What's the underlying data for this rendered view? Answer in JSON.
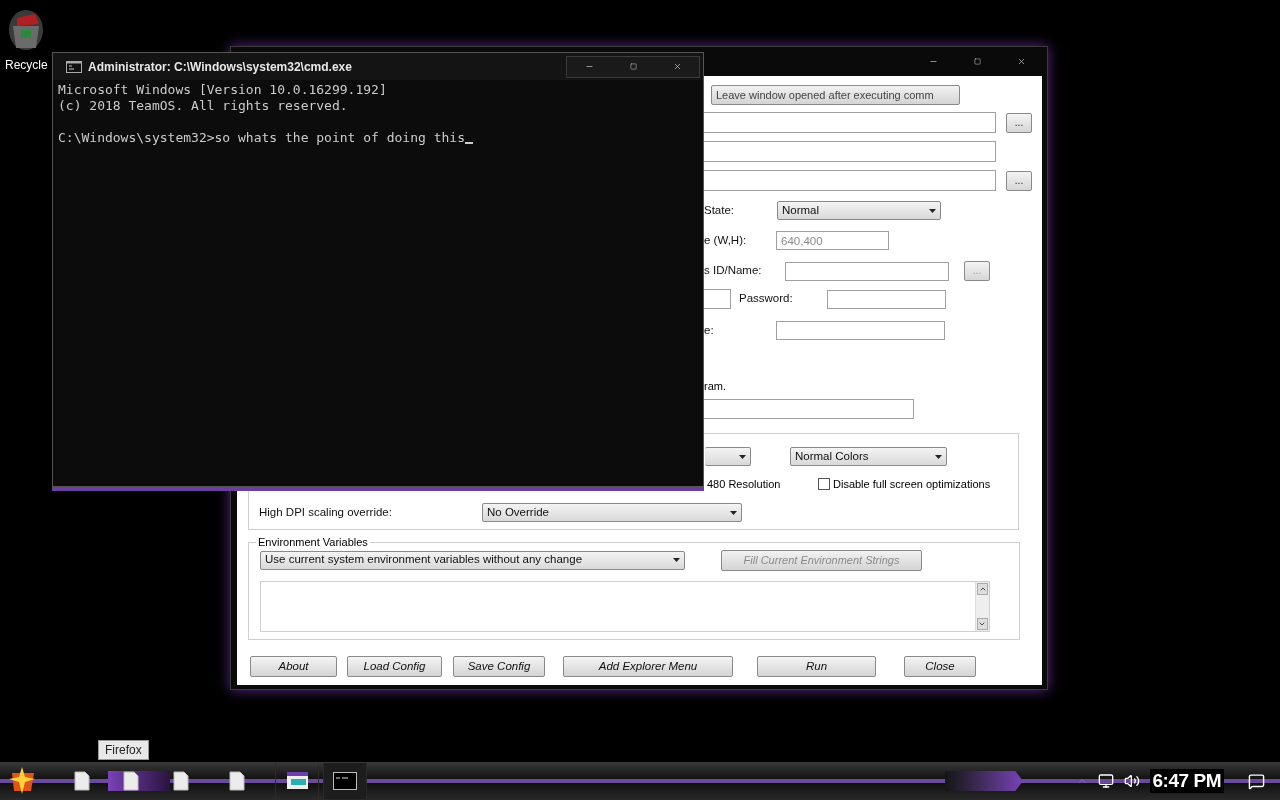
{
  "desktop_icons": [
    {
      "label": "Recycle"
    }
  ],
  "cmd_window": {
    "title": "Administrator: C:\\Windows\\system32\\cmd.exe",
    "lines": [
      "Microsoft Windows [Version 10.0.16299.192]",
      "(c) 2018 TeamOS. All rights reserved."
    ],
    "prompt": "C:\\Windows\\system32>so whats the point of doing this"
  },
  "dialog": {
    "leave_open_button": {
      "label": "Leave window opened after executing comm"
    },
    "path_fields": [
      {
        "kind": "browse",
        "browse": {
          "label": "...",
          "disabled": false
        }
      },
      {
        "kind": "plain"
      },
      {
        "kind": "browse",
        "browse": {
          "label": "...",
          "disabled": false
        }
      }
    ],
    "window_state": {
      "label": "State:",
      "value": "Normal"
    },
    "window_size": {
      "label": "e (W,H):",
      "placeholder": "640,400"
    },
    "process": {
      "label": "s ID/Name:",
      "browse": {
        "label": "...",
        "disabled": true
      }
    },
    "password": {
      "label": "Password:"
    },
    "row_e": {
      "label": "e:"
    },
    "note": "ram.",
    "compat": {
      "color_mode": "Normal Colors",
      "resolution_label": "480 Resolution",
      "fullscreen_opt": {
        "label": "Disable full screen optimizations",
        "checked": false
      },
      "dpi": {
        "label": "High DPI scaling override:",
        "value": "No Override"
      }
    },
    "environment": {
      "title": "Environment Variables",
      "mode": "Use current system environment variables without any change",
      "fill_button": {
        "label": "Fill Current Environment Strings",
        "disabled": true
      }
    },
    "buttons": [
      "About",
      "Load Config",
      "Save Config",
      "Add Explorer Menu",
      "Run",
      "Close"
    ]
  },
  "taskbar": {
    "tooltip": "Firefox",
    "clock": "6:47 PM"
  }
}
